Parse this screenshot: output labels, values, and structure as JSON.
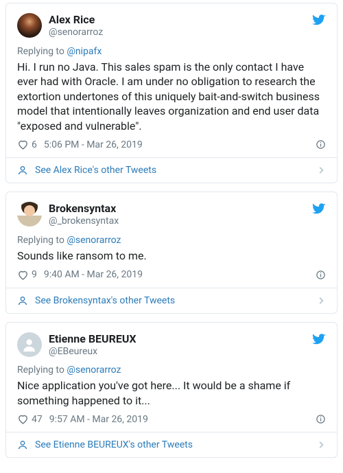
{
  "tweets": [
    {
      "avatar_type": "img1",
      "display_name": "Alex Rice",
      "handle": "@senorarroz",
      "reply_prefix": "Replying to ",
      "reply_to": "@nipafx",
      "text": "Hi. I run no Java. This sales spam is the only contact I have ever had with Oracle. I am under no obligation to research the extortion undertones of this uniquely bait-and-switch business model that intentionally leaves organization and end user data \"exposed and vulnerable\".",
      "likes": "6",
      "time": "5:06 PM - Mar 26, 2019",
      "see_more": "See Alex Rice's other Tweets"
    },
    {
      "avatar_type": "img2",
      "display_name": "Brokensyntax",
      "handle": "@_brokensyntax",
      "reply_prefix": "Replying to ",
      "reply_to": "@senorarroz",
      "text": "Sounds like ransom to me.",
      "likes": "9",
      "time": "9:40 AM - Mar 26, 2019",
      "see_more": "See Brokensyntax's other Tweets"
    },
    {
      "avatar_type": "default",
      "display_name": "Etienne BEUREUX",
      "handle": "@EBeureux",
      "reply_prefix": "Replying to ",
      "reply_to": "@senorarroz",
      "text": "Nice application you've got here... It would be a shame if something happened to it...",
      "likes": "47",
      "time": "9:57 AM - Mar 26, 2019",
      "see_more": "See Etienne BEUREUX's other Tweets"
    }
  ]
}
